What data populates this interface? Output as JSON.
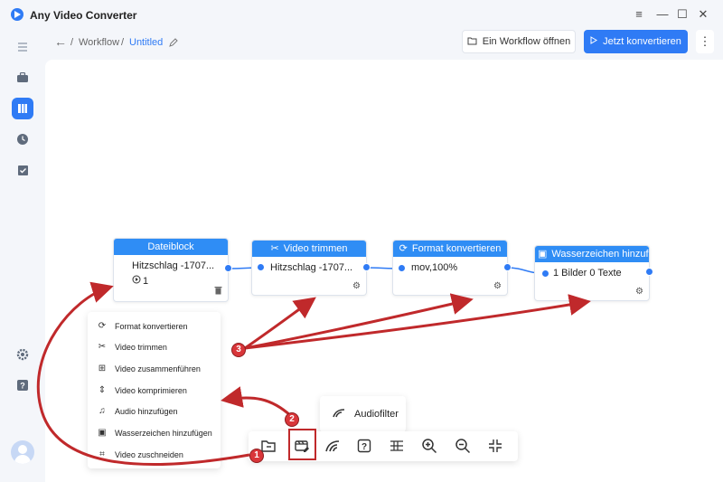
{
  "window": {
    "title": "Any Video Converter"
  },
  "window_controls": {
    "menu_icon": "hamburger-menu-icon",
    "minimize_icon": "minimize-icon",
    "maximize_icon": "maximize-icon",
    "close_icon": "close-icon"
  },
  "sidebar": {
    "items": [
      {
        "name": "toolbox",
        "icon": "briefcase-icon"
      },
      {
        "name": "workflow",
        "icon": "book-icon",
        "active": true
      },
      {
        "name": "history",
        "icon": "clock-icon"
      },
      {
        "name": "tasks",
        "icon": "checklist-icon"
      }
    ],
    "bottom": [
      {
        "name": "settings",
        "icon": "gear-icon"
      },
      {
        "name": "help",
        "icon": "question-icon"
      }
    ]
  },
  "breadcrumb": {
    "root": "Workflow",
    "separator": "/",
    "current": "Untitled"
  },
  "header": {
    "open_workflow": "Ein Workflow öffnen",
    "convert_now": "Jetzt konvertieren"
  },
  "nodes": [
    {
      "title": "Dateiblock",
      "line1": "Hitzschlag -1707...",
      "line2": "1"
    },
    {
      "title": "Video trimmen",
      "line1": "Hitzschlag -1707..."
    },
    {
      "title": "Format konvertieren",
      "line1": "mov,100%"
    },
    {
      "title": "Wasserzeichen hinzufügen",
      "line1": "1 Bilder 0 Texte"
    }
  ],
  "menu": {
    "items": [
      {
        "label": "Format konvertieren",
        "icon": "convert-icon"
      },
      {
        "label": "Video trimmen",
        "icon": "scissors-icon"
      },
      {
        "label": "Video zusammenführen",
        "icon": "merge-icon"
      },
      {
        "label": "Video komprimieren",
        "icon": "compress-icon"
      },
      {
        "label": "Audio hinzufügen",
        "icon": "audio-add-icon"
      },
      {
        "label": "Wasserzeichen hinzufügen",
        "icon": "watermark-icon"
      },
      {
        "label": "Video zuschneiden",
        "icon": "crop-icon"
      }
    ]
  },
  "toolbar": {
    "items": [
      "folder-icon",
      "video-edit-icon",
      "audio-filter-icon",
      "help-box-icon",
      "list-icon",
      "zoom-in-icon",
      "zoom-out-icon",
      "fit-screen-icon"
    ]
  },
  "popover": {
    "label": "Audiofilter"
  },
  "annotations": {
    "badges": [
      "1",
      "2",
      "3"
    ],
    "color": "#d9363a"
  },
  "colors": {
    "accent": "#2f7bf5",
    "node_header": "#2f8df5"
  }
}
